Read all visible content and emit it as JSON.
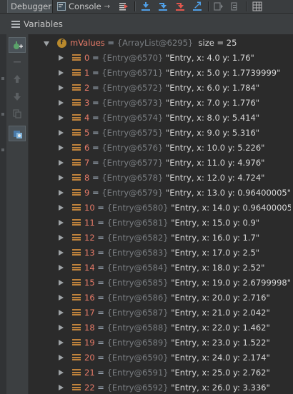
{
  "tabs": {
    "debugger_label": "Debugger",
    "console_label": "Console",
    "console_pin": "→"
  },
  "panel": {
    "title": "Variables"
  },
  "root_var": {
    "name": "mValues",
    "eq": " = ",
    "ref": "{ArrayList@6295}",
    "size_label": "size = 25"
  },
  "entries": [
    {
      "index": "0",
      "ref": "{Entry@6570}",
      "value": "\"Entry, x: 4.0 y: 1.76\""
    },
    {
      "index": "1",
      "ref": "{Entry@6571}",
      "value": "\"Entry, x: 5.0 y: 1.7739999\""
    },
    {
      "index": "2",
      "ref": "{Entry@6572}",
      "value": "\"Entry, x: 6.0 y: 1.784\""
    },
    {
      "index": "3",
      "ref": "{Entry@6573}",
      "value": "\"Entry, x: 7.0 y: 1.776\""
    },
    {
      "index": "4",
      "ref": "{Entry@6574}",
      "value": "\"Entry, x: 8.0 y: 5.414\""
    },
    {
      "index": "5",
      "ref": "{Entry@6575}",
      "value": "\"Entry, x: 9.0 y: 5.316\""
    },
    {
      "index": "6",
      "ref": "{Entry@6576}",
      "value": "\"Entry, x: 10.0 y: 5.226\""
    },
    {
      "index": "7",
      "ref": "{Entry@6577}",
      "value": "\"Entry, x: 11.0 y: 4.976\""
    },
    {
      "index": "8",
      "ref": "{Entry@6578}",
      "value": "\"Entry, x: 12.0 y: 4.724\""
    },
    {
      "index": "9",
      "ref": "{Entry@6579}",
      "value": "\"Entry, x: 13.0 y: 0.96400005\""
    },
    {
      "index": "10",
      "ref": "{Entry@6580}",
      "value": "\"Entry, x: 14.0 y: 0.96400005\""
    },
    {
      "index": "11",
      "ref": "{Entry@6581}",
      "value": "\"Entry, x: 15.0 y: 0.9\""
    },
    {
      "index": "12",
      "ref": "{Entry@6582}",
      "value": "\"Entry, x: 16.0 y: 1.7\""
    },
    {
      "index": "13",
      "ref": "{Entry@6583}",
      "value": "\"Entry, x: 17.0 y: 2.5\""
    },
    {
      "index": "14",
      "ref": "{Entry@6584}",
      "value": "\"Entry, x: 18.0 y: 2.52\""
    },
    {
      "index": "15",
      "ref": "{Entry@6585}",
      "value": "\"Entry, x: 19.0 y: 2.6799998\""
    },
    {
      "index": "16",
      "ref": "{Entry@6586}",
      "value": "\"Entry, x: 20.0 y: 2.716\""
    },
    {
      "index": "17",
      "ref": "{Entry@6587}",
      "value": "\"Entry, x: 21.0 y: 2.042\""
    },
    {
      "index": "18",
      "ref": "{Entry@6588}",
      "value": "\"Entry, x: 22.0 y: 1.462\""
    },
    {
      "index": "19",
      "ref": "{Entry@6589}",
      "value": "\"Entry, x: 23.0 y: 1.522\""
    },
    {
      "index": "20",
      "ref": "{Entry@6590}",
      "value": "\"Entry, x: 24.0 y: 2.174\""
    },
    {
      "index": "21",
      "ref": "{Entry@6591}",
      "value": "\"Entry, x: 25.0 y: 2.762\""
    },
    {
      "index": "22",
      "ref": "{Entry@6592}",
      "value": "\"Entry, x: 26.0 y: 3.336\""
    }
  ],
  "icons": {
    "field": "f",
    "array_entry": "array-element-icon",
    "expand": "chevron-right-icon",
    "collapse": "chevron-down-icon"
  },
  "colors": {
    "name": "#e97c6a",
    "ref": "#7a7e82",
    "string": "#d8d8d8",
    "background": "#2b2b2b",
    "field_icon": "#b98a2d",
    "array_icon": "#c0833c"
  }
}
